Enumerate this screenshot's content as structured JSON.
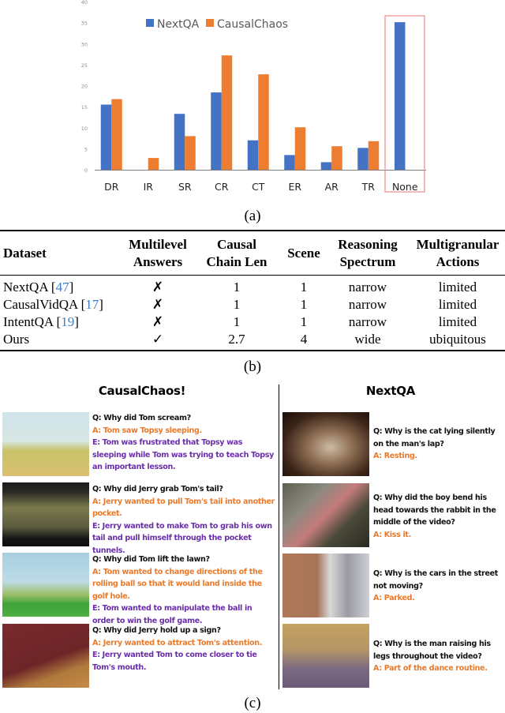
{
  "figure": {
    "caption_a": "(a)",
    "caption_b": "(b)",
    "caption_c": "(c)"
  },
  "chart_data": {
    "type": "bar",
    "title": "",
    "xlabel": "",
    "ylabel": "",
    "categories": [
      "DR",
      "IR",
      "SR",
      "CR",
      "CT",
      "ER",
      "AR",
      "TR",
      "None"
    ],
    "series": [
      {
        "name": "NextQA",
        "color": "#4472c4",
        "values": [
          15.5,
          0,
          13.3,
          18.4,
          7.0,
          3.5,
          1.8,
          5.2,
          35.1
        ]
      },
      {
        "name": "CausalChaos",
        "color": "#ed7d31",
        "values": [
          16.8,
          2.8,
          8.0,
          27.2,
          22.7,
          10.1,
          5.6,
          6.8,
          0
        ]
      }
    ],
    "ylim": [
      0,
      40
    ],
    "yticks": [
      0,
      5,
      10,
      15,
      20,
      25,
      30,
      35,
      40
    ],
    "grid": false,
    "legend": "top-center",
    "highlight": {
      "category": "None",
      "color": "#f08080"
    }
  },
  "table": {
    "headers": [
      [
        "Dataset"
      ],
      [
        "Multilevel",
        "Answers"
      ],
      [
        "Causal",
        "Chain Len"
      ],
      [
        "Scene"
      ],
      [
        "Reasoning",
        "Spectrum"
      ],
      [
        "Multigranular",
        "Actions"
      ]
    ],
    "rows": [
      {
        "dataset": "NextQA",
        "ref": "47",
        "multilevel": "✗",
        "chain_len": "1",
        "scene": "1",
        "spectrum": "narrow",
        "actions": "limited"
      },
      {
        "dataset": "CausalVidQA",
        "ref": "17",
        "multilevel": "✗",
        "chain_len": "1",
        "scene": "1",
        "spectrum": "narrow",
        "actions": "limited"
      },
      {
        "dataset": "IntentQA",
        "ref": "19",
        "multilevel": "✗",
        "chain_len": "1",
        "scene": "1",
        "spectrum": "narrow",
        "actions": "limited"
      },
      {
        "dataset": "Ours",
        "ref": "",
        "multilevel": "✓",
        "chain_len": "2.7",
        "scene": "4",
        "spectrum": "wide",
        "actions": "ubiquitous"
      }
    ]
  },
  "panel_c": {
    "left": {
      "title": "CausalChaos!",
      "items": [
        {
          "thumb": "tom-at-chalkboard",
          "q": "Q: Why did Tom scream?",
          "a": "A: Tom saw Topsy sleeping.",
          "e": "E: Tom was frustrated that Topsy was sleeping while Tom was trying to teach Topsy an important lesson."
        },
        {
          "thumb": "jerry-grabbing-tail",
          "q": "Q: Why did Jerry grab Tom's tail?",
          "a": "A: Jerry wanted to pull Tom's tail into another pocket.",
          "e": "E: Jerry wanted to make Tom to grab his own tail and pull himself through the pocket tunnels."
        },
        {
          "thumb": "tom-golf-lawn",
          "q": "Q: Why did Tom lift the lawn?",
          "a": "A: Tom wanted to change directions of the rolling ball so that it would land inside the golf hole.",
          "e": "E: Tom wanted to manipulate the ball in order to win the golf game."
        },
        {
          "thumb": "jerry-holding-sign",
          "q": "Q: Why did Jerry hold up a sign?",
          "a": "A: Jerry wanted to attract Tom's attention.",
          "e": "E: Jerry wanted Tom to come closer to tie Tom's mouth."
        }
      ]
    },
    "right": {
      "title": "NextQA",
      "items": [
        {
          "thumb": "cat-on-lap",
          "q": "Q: Why is the cat lying silently on the man's lap?",
          "a": "A: Resting."
        },
        {
          "thumb": "boy-with-rabbit",
          "q": "Q: Why did the boy bend his head towards the rabbit in the middle of the video?",
          "a": "A: Kiss it."
        },
        {
          "thumb": "street-cars",
          "q": "Q: Why is the cars in the street not moving?",
          "a": "A: Parked."
        },
        {
          "thumb": "dancing-man",
          "q": "Q: Why is the man raising his legs throughout the video?",
          "a": "A: Part of the dance routine."
        }
      ]
    }
  }
}
